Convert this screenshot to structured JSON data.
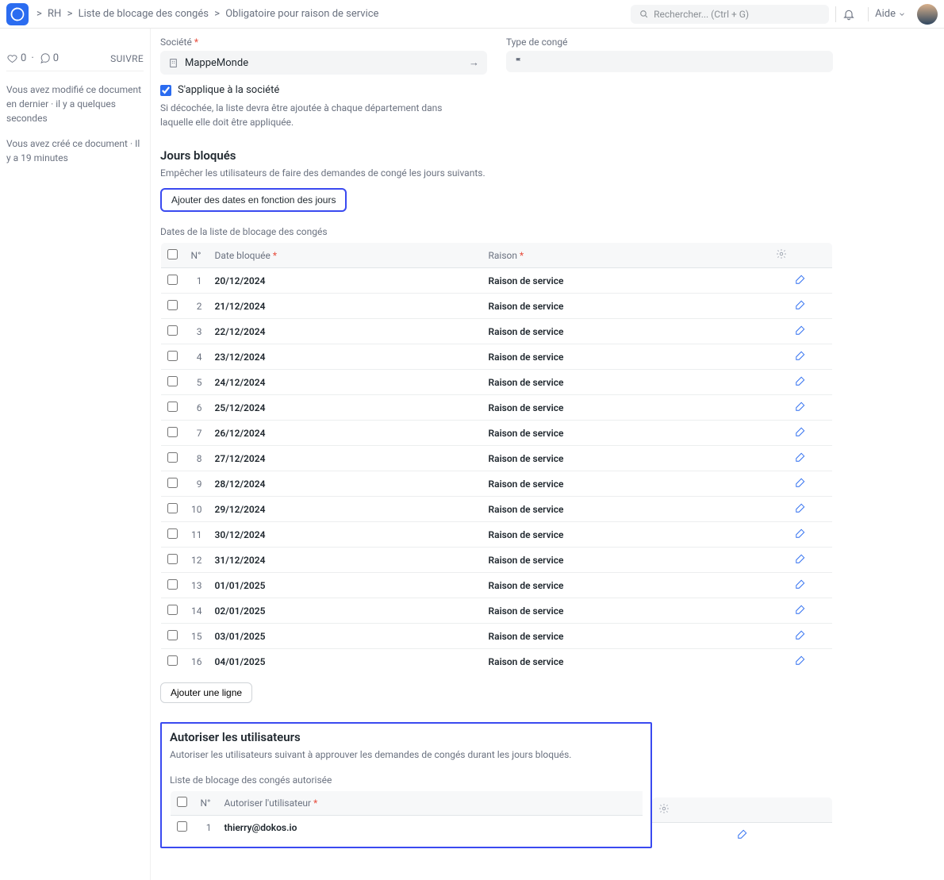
{
  "breadcrumb": {
    "sep": ">",
    "rh": "RH",
    "list": "Liste de blocage des congés",
    "doc": "Obligatoire pour raison de service"
  },
  "search": {
    "placeholder": "Rechercher... (Ctrl + G)"
  },
  "help": {
    "label": "Aide"
  },
  "social": {
    "likes": "0",
    "comments": "0",
    "follow": "SUIVRE"
  },
  "meta": {
    "modified": "Vous avez modifié ce document en dernier · il y a quelques secondes",
    "created": "Vous avez créé ce document · Il y a 19 minutes"
  },
  "fields": {
    "company_label": "Société",
    "company_value": "MappeMonde",
    "leavetype_label": "Type de congé",
    "applies_company": "S'applique à la société",
    "applies_help": "Si décochée, la liste devra être ajoutée à chaque département dans laquelle elle doit être appliquée."
  },
  "blocked": {
    "title": "Jours bloqués",
    "desc": "Empêcher les utilisateurs de faire des demandes de congé les jours suivants.",
    "add_btn": "Ajouter des dates en fonction des jours",
    "subsection": "Dates de la liste de blocage des congés",
    "cols": {
      "num": "N°",
      "date": "Date bloquée",
      "reason": "Raison"
    },
    "rows": [
      {
        "n": "1",
        "date": "20/12/2024",
        "reason": "Raison de service"
      },
      {
        "n": "2",
        "date": "21/12/2024",
        "reason": "Raison de service"
      },
      {
        "n": "3",
        "date": "22/12/2024",
        "reason": "Raison de service"
      },
      {
        "n": "4",
        "date": "23/12/2024",
        "reason": "Raison de service"
      },
      {
        "n": "5",
        "date": "24/12/2024",
        "reason": "Raison de service"
      },
      {
        "n": "6",
        "date": "25/12/2024",
        "reason": "Raison de service"
      },
      {
        "n": "7",
        "date": "26/12/2024",
        "reason": "Raison de service"
      },
      {
        "n": "8",
        "date": "27/12/2024",
        "reason": "Raison de service"
      },
      {
        "n": "9",
        "date": "28/12/2024",
        "reason": "Raison de service"
      },
      {
        "n": "10",
        "date": "29/12/2024",
        "reason": "Raison de service"
      },
      {
        "n": "11",
        "date": "30/12/2024",
        "reason": "Raison de service"
      },
      {
        "n": "12",
        "date": "31/12/2024",
        "reason": "Raison de service"
      },
      {
        "n": "13",
        "date": "01/01/2025",
        "reason": "Raison de service"
      },
      {
        "n": "14",
        "date": "02/01/2025",
        "reason": "Raison de service"
      },
      {
        "n": "15",
        "date": "03/01/2025",
        "reason": "Raison de service"
      },
      {
        "n": "16",
        "date": "04/01/2025",
        "reason": "Raison de service"
      }
    ],
    "add_row": "Ajouter une ligne"
  },
  "allow": {
    "title": "Autoriser les utilisateurs",
    "desc": "Autoriser les utilisateurs suivant à approuver les demandes de congés durant les jours bloqués.",
    "subsection": "Liste de blocage des congés autorisée",
    "cols": {
      "num": "N°",
      "user": "Autoriser l'utilisateur"
    },
    "rows": [
      {
        "n": "1",
        "user": "thierry@dokos.io"
      }
    ]
  }
}
